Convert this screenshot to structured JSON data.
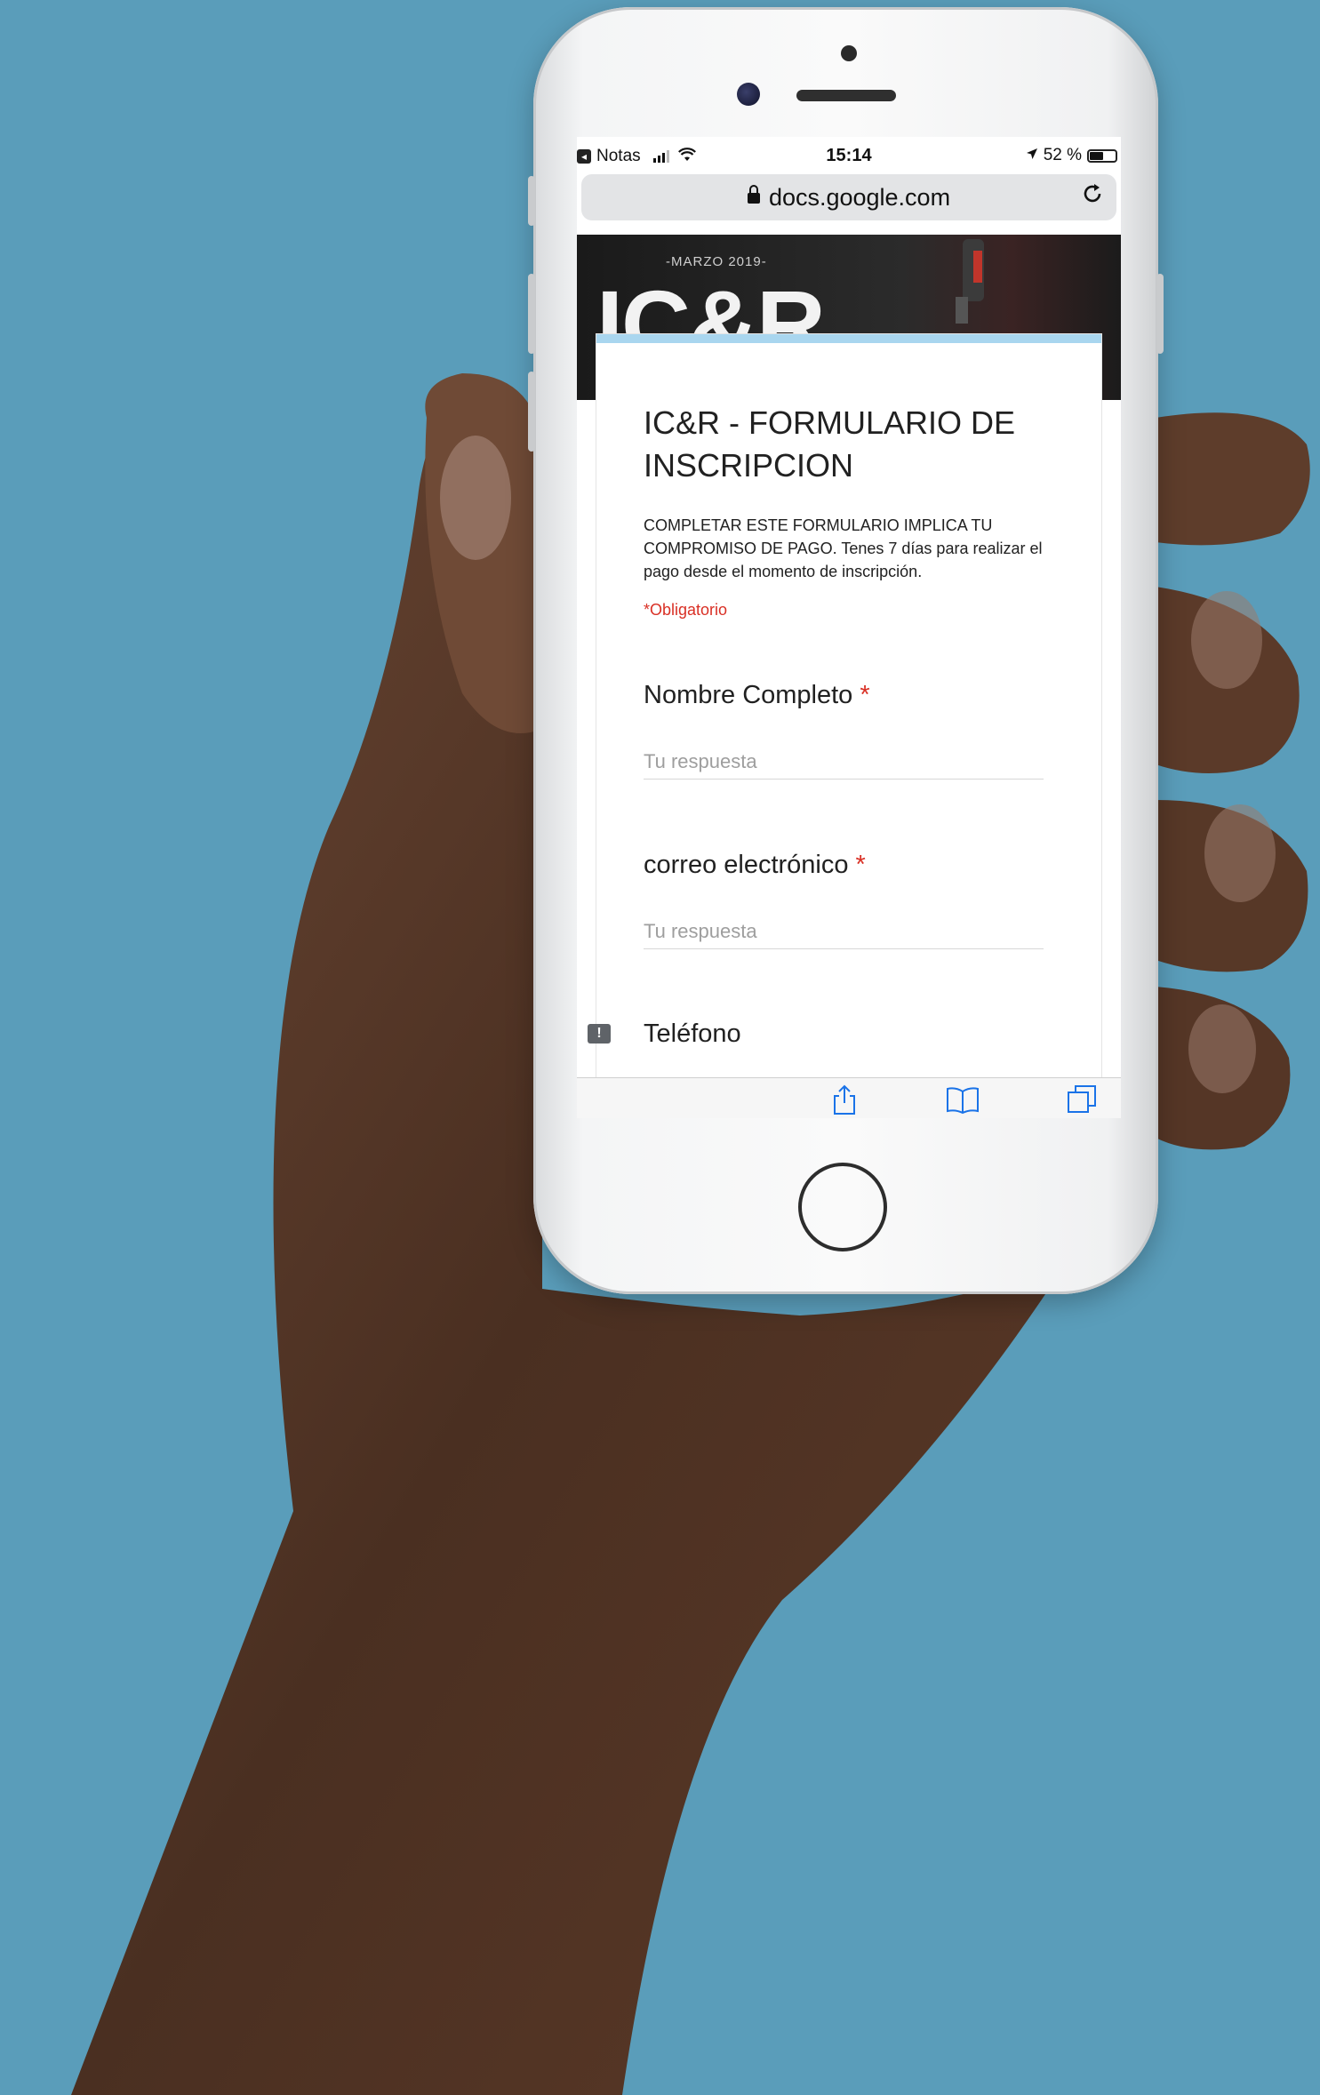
{
  "statusbar": {
    "back_app": "Notas",
    "time": "15:14",
    "battery_text": "52 %",
    "battery_level": 0.52
  },
  "browser": {
    "url": "docs.google.com"
  },
  "banner": {
    "subtitle": "-MARZO 2019-",
    "logo": "IC&R"
  },
  "form": {
    "title": "IC&R - FORMULARIO DE INSCRIPCION",
    "description": "COMPLETAR ESTE FORMULARIO IMPLICA TU COMPROMISO DE PAGO. Tenes 7 días para realizar el pago desde el momento de inscripción.",
    "required_note": "*Obligatorio",
    "questions": [
      {
        "label": "Nombre Completo",
        "required_mark": "*",
        "placeholder": "Tu respuesta"
      },
      {
        "label": "correo electrónico",
        "required_mark": "*",
        "placeholder": "Tu respuesta"
      },
      {
        "label": "Teléfono"
      }
    ]
  },
  "colors": {
    "background": "#5a9dba",
    "form_accent": "#a9d6ef",
    "required": "#d93025",
    "ios_blue": "#1a73e8"
  },
  "icons": [
    "lock-icon",
    "reload-icon",
    "share-icon",
    "bookmarks-icon",
    "tabs-icon",
    "feedback-icon",
    "wifi-icon",
    "location-icon"
  ]
}
